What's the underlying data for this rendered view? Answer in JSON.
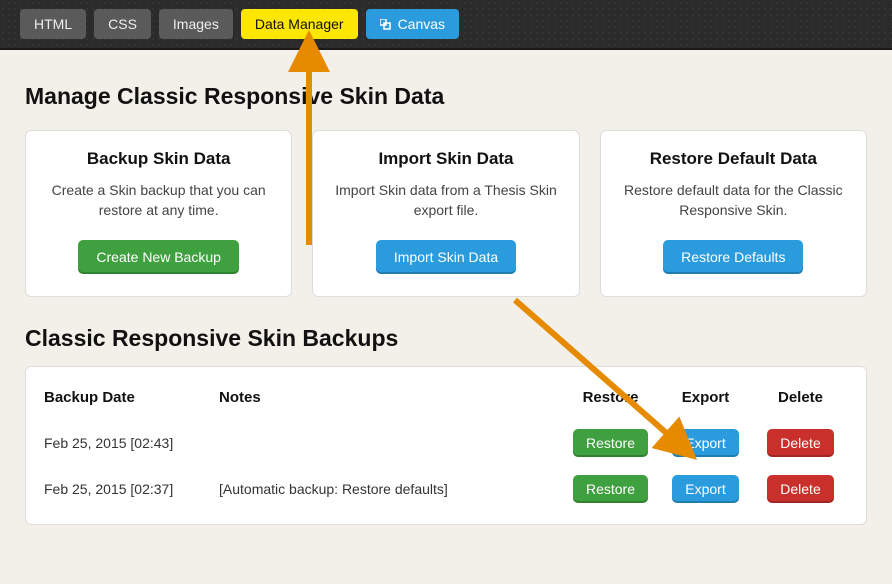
{
  "tabs": {
    "html": "HTML",
    "css": "CSS",
    "images": "Images",
    "datamanager": "Data Manager",
    "canvas": "Canvas"
  },
  "heading1": "Manage Classic Responsive Skin Data",
  "cards": {
    "backup": {
      "title": "Backup Skin Data",
      "desc": "Create a Skin backup that you can restore at any time.",
      "btn": "Create New Backup"
    },
    "import": {
      "title": "Import Skin Data",
      "desc": "Import Skin data from a Thesis Skin export file.",
      "btn": "Import Skin Data"
    },
    "restore": {
      "title": "Restore Default Data",
      "desc": "Restore default data for the Classic Responsive Skin.",
      "btn": "Restore Defaults"
    }
  },
  "heading2": "Classic Responsive Skin Backups",
  "table": {
    "headers": {
      "date": "Backup Date",
      "notes": "Notes",
      "restore": "Restore",
      "export": "Export",
      "delete": "Delete"
    },
    "buttons": {
      "restore": "Restore",
      "export": "Export",
      "delete": "Delete"
    },
    "rows": [
      {
        "date": "Feb 25, 2015 [02:43]",
        "notes": ""
      },
      {
        "date": "Feb 25, 2015 [02:37]",
        "notes": "[Automatic backup: Restore defaults]"
      }
    ]
  },
  "annotation_color": "#e68a00"
}
